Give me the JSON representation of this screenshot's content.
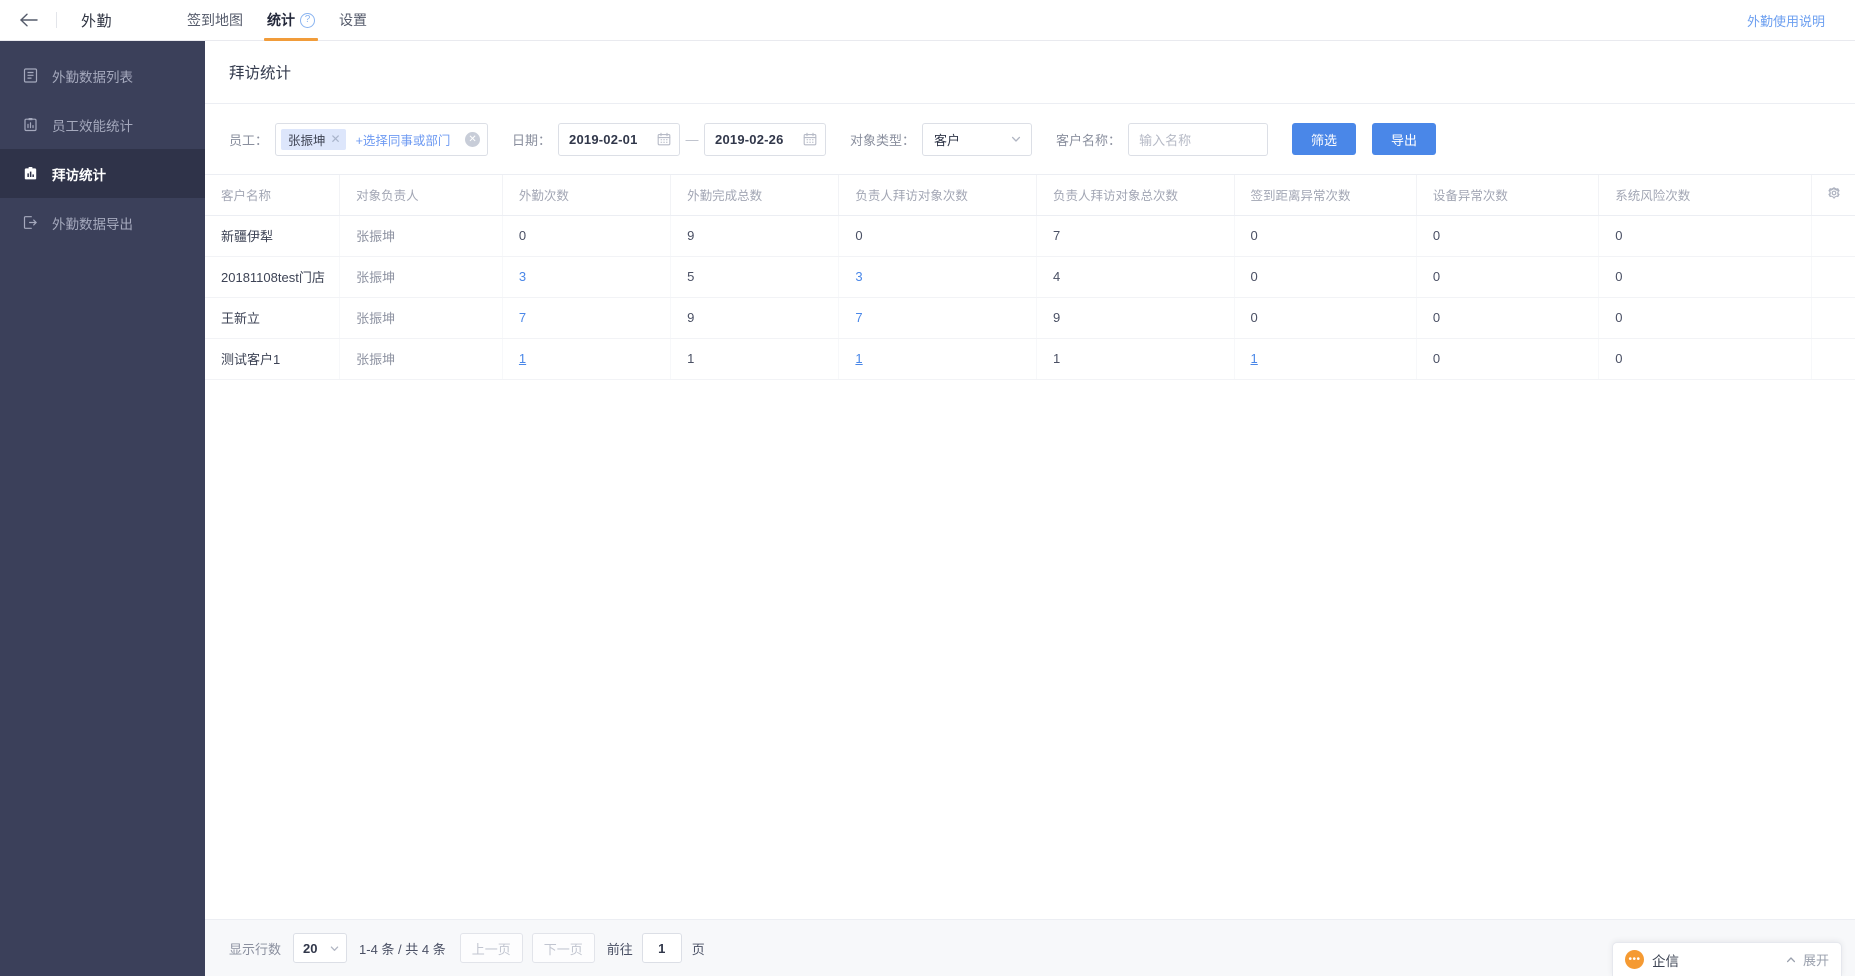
{
  "topbar": {
    "back_icon": "arrow-left-icon",
    "app_name": "外勤",
    "tabs": [
      {
        "label": "签到地图",
        "active": false,
        "has_help": false
      },
      {
        "label": "统计",
        "active": true,
        "has_help": true,
        "help_glyph": "?"
      },
      {
        "label": "设置",
        "active": false,
        "has_help": false
      }
    ],
    "help_link": "外勤使用说明",
    "accent_color": "#f19c3a",
    "link_color": "#6c9ff0"
  },
  "sidebar": {
    "background": "#3b405a",
    "active_background": "#2f3349",
    "items": [
      {
        "label": "外勤数据列表",
        "icon": "list-doc-icon",
        "active": false
      },
      {
        "label": "员工效能统计",
        "icon": "clipboard-chart-icon",
        "active": false
      },
      {
        "label": "拜访统计",
        "icon": "bar-chart-board-icon",
        "active": true
      },
      {
        "label": "外勤数据导出",
        "icon": "export-icon",
        "active": false
      }
    ]
  },
  "page": {
    "title": "拜访统计"
  },
  "filters": {
    "employee": {
      "label": "员工：",
      "chip": "张振坤",
      "chip_remove_icon": "close-small-icon",
      "add_text": "+选择同事或部门",
      "clear_icon": "clear-circle-icon",
      "clear_glyph": "✕"
    },
    "date": {
      "label": "日期：",
      "start": "2019-02-01",
      "end": "2019-02-26",
      "separator": "—",
      "calendar_icon": "calendar-icon"
    },
    "object_type": {
      "label": "对象类型：",
      "value": "客户",
      "chevron_icon": "chevron-down-icon"
    },
    "customer_name": {
      "label": "客户名称：",
      "value": "",
      "placeholder": "输入名称"
    },
    "filter_button": "筛选",
    "export_button": "导出",
    "button_color": "#4a87e8"
  },
  "table": {
    "settings_icon": "gear-icon",
    "columns": [
      "客户名称",
      "对象负责人",
      "外勤次数",
      "外勤完成总数",
      "负责人拜访对象次数",
      "负责人拜访对象总次数",
      "签到距离异常次数",
      "设备异常次数",
      "系统风险次数"
    ],
    "rows": [
      {
        "客户名称": "新疆伊犁",
        "对象负责人": "张振坤",
        "外勤次数": "0",
        "外勤完成总数": "9",
        "负责人拜访对象次数": "0",
        "负责人拜访对象总次数": "7",
        "签到距离异常次数": "0",
        "设备异常次数": "0",
        "系统风险次数": "0",
        "links": []
      },
      {
        "客户名称": "20181108test门店",
        "对象负责人": "张振坤",
        "外勤次数": "3",
        "外勤完成总数": "5",
        "负责人拜访对象次数": "3",
        "负责人拜访对象总次数": "4",
        "签到距离异常次数": "0",
        "设备异常次数": "0",
        "系统风险次数": "0",
        "links": [
          "外勤次数",
          "负责人拜访对象次数"
        ]
      },
      {
        "客户名称": "王新立",
        "对象负责人": "张振坤",
        "外勤次数": "7",
        "外勤完成总数": "9",
        "负责人拜访对象次数": "7",
        "负责人拜访对象总次数": "9",
        "签到距离异常次数": "0",
        "设备异常次数": "0",
        "系统风险次数": "0",
        "links": [
          "外勤次数",
          "负责人拜访对象次数"
        ]
      },
      {
        "客户名称": "测试客户1",
        "对象负责人": "张振坤",
        "外勤次数": "1",
        "外勤完成总数": "1",
        "负责人拜访对象次数": "1",
        "负责人拜访对象总次数": "1",
        "签到距离异常次数": "1",
        "设备异常次数": "0",
        "系统风险次数": "0",
        "links": [
          "外勤次数",
          "负责人拜访对象次数",
          "签到距离异常次数"
        ]
      }
    ],
    "link_color": "#4a87e8"
  },
  "pagination": {
    "rows_label": "显示行数",
    "rows_value": "20",
    "rows_chevron_icon": "chevron-down-icon",
    "range_text": "1-4 条 / 共 4 条",
    "prev_label": "上一页",
    "next_label": "下一页",
    "goto_label": "前往",
    "goto_value": "1",
    "page_unit": "页"
  },
  "chat_widget": {
    "badge_icon": "chat-dots-icon",
    "badge_glyph": "•••",
    "name": "企信",
    "caret_icon": "chevron-up-icon",
    "expand_label": "展开",
    "badge_color": "#f59a32"
  }
}
